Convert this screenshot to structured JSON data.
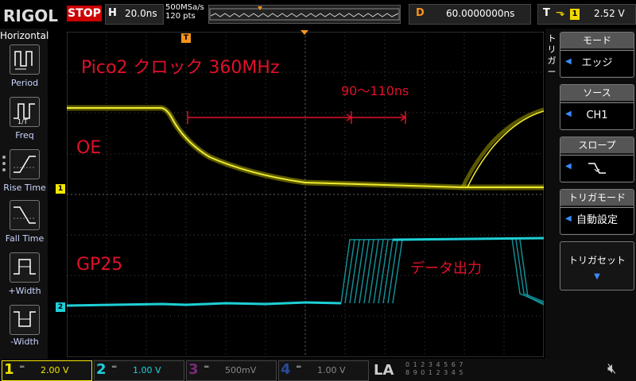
{
  "topbar": {
    "brand": "RIGOL",
    "run_state": "STOP",
    "timebase_key": "H",
    "timebase_value": "20.0ns",
    "sample_rate": "500MSa/s",
    "points": "120 pts",
    "delay_key": "D",
    "delay_value": "60.0000000ns",
    "trigger_key": "T",
    "trigger_channel": "1",
    "trigger_level": "2.52 V"
  },
  "left_panel": {
    "title": "Horizontal",
    "items": [
      {
        "label": "Period"
      },
      {
        "label": "Freq"
      },
      {
        "label": "Rise Time"
      },
      {
        "label": "Fall Time"
      },
      {
        "label": "+Width"
      },
      {
        "label": "-Width"
      }
    ]
  },
  "screen": {
    "annotation_title": "Pico2 クロック 360MHz",
    "annotation_oe": "OE",
    "annotation_gp25": "GP25",
    "annotation_range": "90〜110ns",
    "annotation_data": "データ出力",
    "marker_ch1": "1",
    "marker_ch2": "2",
    "marker_trigger": "T"
  },
  "right_panel": {
    "title": "トリガー",
    "mode": {
      "label": "モード",
      "value": "エッジ"
    },
    "source": {
      "label": "ソース",
      "value": "CH1"
    },
    "slope": {
      "label": "スロープ",
      "value": "⌄"
    },
    "sweep": {
      "label": "トリガモード",
      "value": "自動設定"
    },
    "setting": {
      "label": "トリガセット",
      "arrow": "▼"
    }
  },
  "channels": [
    {
      "num": "1",
      "scale": "2.00 V",
      "color": "#f2e600"
    },
    {
      "num": "2",
      "scale": "1.00 V",
      "color": "#1fd0e0"
    },
    {
      "num": "3",
      "scale": "500mV",
      "color": "#c030c0"
    },
    {
      "num": "4",
      "scale": "1.00 V",
      "color": "#2060ff"
    }
  ],
  "bottombar": {
    "la_label": "LA",
    "la_digits_row1": "0 1 2 3   4 5 6 7",
    "la_digits_row2": "8 9 0 1   2 3 4 5"
  },
  "colors": {
    "ch1": "#e8e400",
    "ch2": "#1ecfd6",
    "annotation": "#e0102a",
    "trigger_marker": "#f7941d"
  }
}
